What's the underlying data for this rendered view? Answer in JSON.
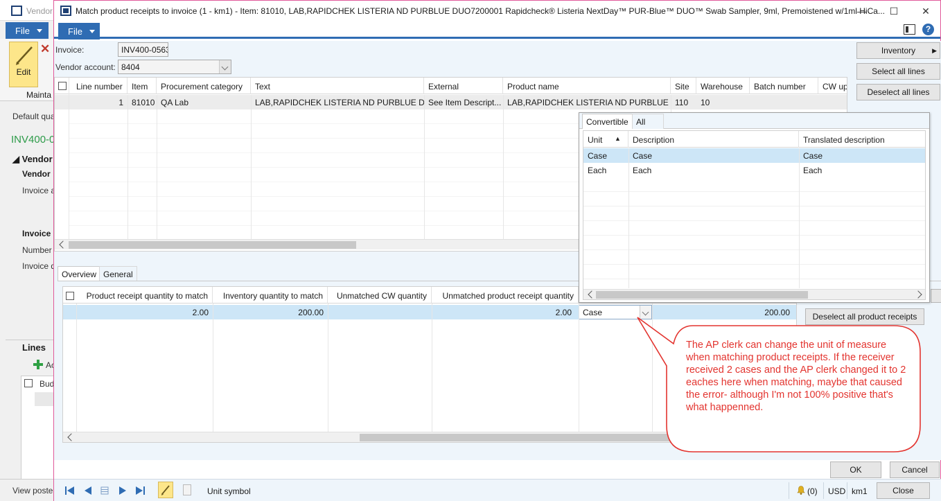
{
  "bg_window": {
    "title": "Vendor",
    "file_label": "File",
    "edit_label": "Edit",
    "maint_label": "Mainta",
    "default_qty_label": "Default qua",
    "invoice_id": "INV400-0",
    "vendor_section": "Vendor",
    "vendor_sub": "Vendor",
    "invoice_a": "Invoice a",
    "invoice_section": "Invoice",
    "number_label": "Number",
    "invoice_d": "Invoice d",
    "lines_label": "Lines",
    "add_label": "Ac",
    "bud_label": "Bud",
    "view_posted": "View poste"
  },
  "dialog": {
    "title": "Match product receipts to invoice (1 - km1) - Item: 81010, LAB,RAPIDCHEK LISTERIA ND PURBLUE DUO7200001 Rapidcheck® Listeria NextDay™ PUR-Blue™ DUO™ Swab Sampler, 9ml, Premoistened w/1ml HiCa...",
    "file_label": "File",
    "help_label": "?",
    "invoice_label": "Invoice:",
    "invoice_value": "INV400-0563",
    "vendor_account_label": "Vendor account:",
    "vendor_account_value": "8404"
  },
  "side_buttons": {
    "inventory": "Inventory",
    "select_all": "Select all lines",
    "deselect_all": "Deselect all lines",
    "deselect_receipts": "Deselect all product receipts"
  },
  "lines_grid": {
    "headers": [
      "Line number",
      "Item",
      "Procurement category",
      "Text",
      "External",
      "Product name",
      "Site",
      "Warehouse",
      "Batch number",
      "CW up"
    ],
    "rows": [
      [
        "1",
        "81010",
        "QA Lab",
        "LAB,RAPIDCHEK LISTERIA ND PURBLUE DUO",
        "See Item Descript...",
        "LAB,RAPIDCHEK LISTERIA ND PURBLUE D...",
        "110",
        "10",
        "",
        ""
      ]
    ]
  },
  "lower_tabs": [
    "Overview",
    "General"
  ],
  "receipt_grid": {
    "headers": [
      "Product receipt quantity to match",
      "Inventory quantity to match",
      "Unmatched CW quantity",
      "Unmatched product receipt quantity"
    ],
    "row": {
      "receipt_qty": "2.00",
      "inventory_qty": "200.00",
      "cw_qty": "",
      "unmatched_qty": "2.00",
      "unit": "Case",
      "extra_qty": "200.00"
    }
  },
  "unit_popup": {
    "tabs": [
      "Convertible",
      "All"
    ],
    "headers": [
      "Unit",
      "Description",
      "Translated description"
    ],
    "rows": [
      [
        "Case",
        "Case",
        "Case"
      ],
      [
        "Each",
        "Each",
        "Each"
      ]
    ]
  },
  "callout": {
    "text": "The AP clerk can change the unit of measure when matching product receipts. If the receiver received 2 cases and the AP clerk changed it to 2 eaches here when matching, maybe that caused the error- although I'm not 100% positive that's what happenned.",
    "color": "#e3342f"
  },
  "footer": {
    "ok": "OK",
    "cancel": "Cancel",
    "close": "Close"
  },
  "status_bar": {
    "field_label": "Unit symbol",
    "notifications": "(0)",
    "currency": "USD",
    "company": "km1"
  },
  "colors": {
    "accent": "#2f6cb3",
    "selected_row": "#cde6f7",
    "edit_button": "#fde68a"
  }
}
